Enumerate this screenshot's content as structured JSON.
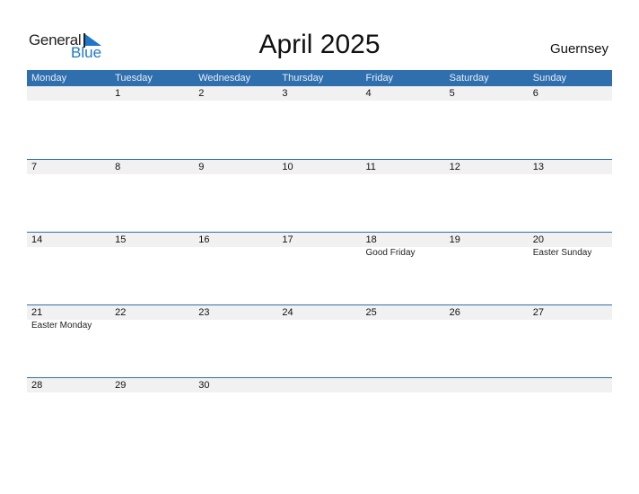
{
  "logo": {
    "general": "General",
    "blue": "Blue",
    "brand_color": "#1e77c9"
  },
  "header": {
    "title": "April 2025",
    "country": "Guernsey"
  },
  "colors": {
    "header_bg": "#2f6fae",
    "date_strip_bg": "#f1f1f1"
  },
  "weekdays": [
    "Monday",
    "Tuesday",
    "Wednesday",
    "Thursday",
    "Friday",
    "Saturday",
    "Sunday"
  ],
  "weeks": [
    [
      {
        "day": ""
      },
      {
        "day": "1"
      },
      {
        "day": "2"
      },
      {
        "day": "3"
      },
      {
        "day": "4"
      },
      {
        "day": "5"
      },
      {
        "day": "6"
      }
    ],
    [
      {
        "day": "7"
      },
      {
        "day": "8"
      },
      {
        "day": "9"
      },
      {
        "day": "10"
      },
      {
        "day": "11"
      },
      {
        "day": "12"
      },
      {
        "day": "13"
      }
    ],
    [
      {
        "day": "14"
      },
      {
        "day": "15"
      },
      {
        "day": "16"
      },
      {
        "day": "17"
      },
      {
        "day": "18",
        "event": "Good Friday"
      },
      {
        "day": "19"
      },
      {
        "day": "20",
        "event": "Easter Sunday"
      }
    ],
    [
      {
        "day": "21",
        "event": "Easter Monday"
      },
      {
        "day": "22"
      },
      {
        "day": "23"
      },
      {
        "day": "24"
      },
      {
        "day": "25"
      },
      {
        "day": "26"
      },
      {
        "day": "27"
      }
    ],
    [
      {
        "day": "28"
      },
      {
        "day": "29"
      },
      {
        "day": "30"
      },
      {
        "day": ""
      },
      {
        "day": ""
      },
      {
        "day": ""
      },
      {
        "day": ""
      }
    ]
  ]
}
